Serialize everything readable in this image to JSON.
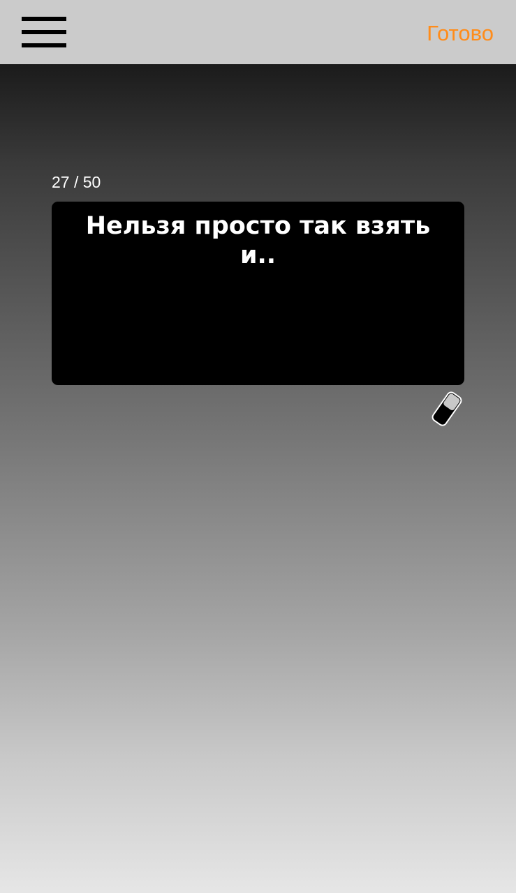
{
  "header": {
    "done_label": "Готово"
  },
  "editor": {
    "counter": "27 / 50",
    "text": "Нельзя просто так взять и.."
  },
  "icons": {
    "menu": "menu-icon",
    "eraser": "eraser-icon"
  },
  "colors": {
    "accent": "#ff8c1a",
    "topbar_bg": "#cbcbcb",
    "card_bg": "#000000",
    "text": "#ffffff"
  }
}
